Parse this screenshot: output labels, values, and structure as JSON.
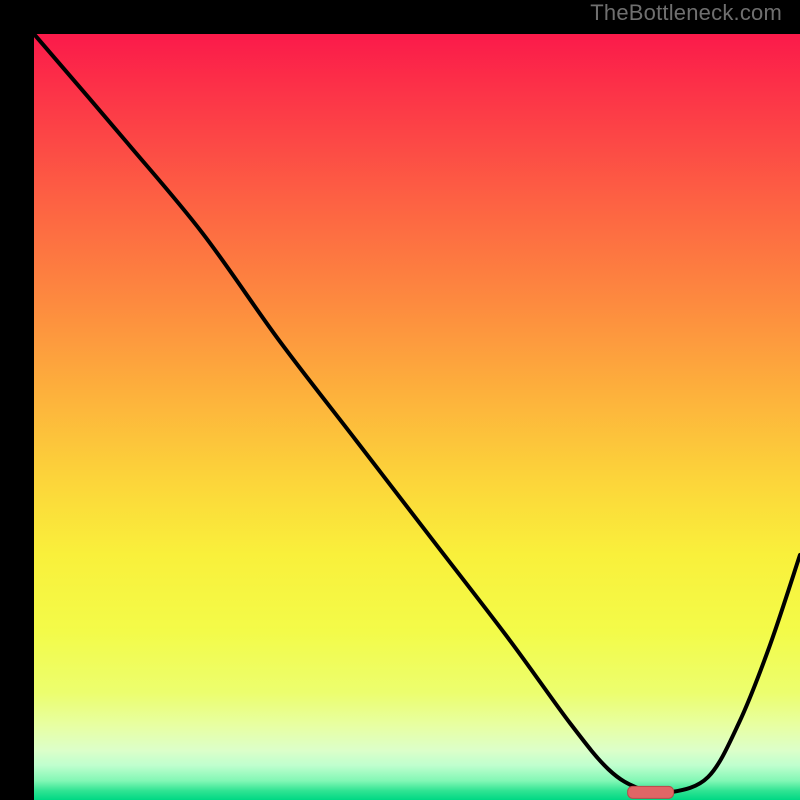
{
  "watermark": "TheBottleneck.com",
  "colors": {
    "frame": "#000000",
    "curve": "#000000",
    "marker_fill": "#e06666",
    "marker_stroke": "#b84a4a",
    "gradient_stops": [
      {
        "offset": 0.0,
        "color": "#fb1a4a"
      },
      {
        "offset": 0.1,
        "color": "#fc3b47"
      },
      {
        "offset": 0.22,
        "color": "#fd6243"
      },
      {
        "offset": 0.35,
        "color": "#fd8a3f"
      },
      {
        "offset": 0.47,
        "color": "#fdb13c"
      },
      {
        "offset": 0.58,
        "color": "#fcd43a"
      },
      {
        "offset": 0.68,
        "color": "#f9f03b"
      },
      {
        "offset": 0.78,
        "color": "#f3fb49"
      },
      {
        "offset": 0.86,
        "color": "#ecfe6e"
      },
      {
        "offset": 0.905,
        "color": "#e7ffa5"
      },
      {
        "offset": 0.935,
        "color": "#dcffc9"
      },
      {
        "offset": 0.955,
        "color": "#bfffce"
      },
      {
        "offset": 0.975,
        "color": "#82f7b5"
      },
      {
        "offset": 0.988,
        "color": "#30e493"
      },
      {
        "offset": 1.0,
        "color": "#00d884"
      }
    ]
  },
  "chart_data": {
    "type": "line",
    "title": "",
    "xlabel": "",
    "ylabel": "",
    "xlim": [
      0,
      100
    ],
    "ylim": [
      0,
      100
    ],
    "grid": false,
    "series": [
      {
        "name": "bottleneck-curve",
        "x": [
          0,
          12,
          22,
          32,
          42,
          52,
          62,
          70,
          75,
          79,
          83,
          88,
          92,
          96,
          100
        ],
        "y": [
          100,
          86,
          74,
          60,
          47,
          34,
          21,
          10,
          4,
          1.5,
          1,
          3,
          10,
          20,
          32
        ]
      }
    ],
    "optimal_marker": {
      "x_range": [
        77.5,
        83.5
      ],
      "y": 1.0,
      "label": "optimal-zone"
    },
    "legend": null
  }
}
